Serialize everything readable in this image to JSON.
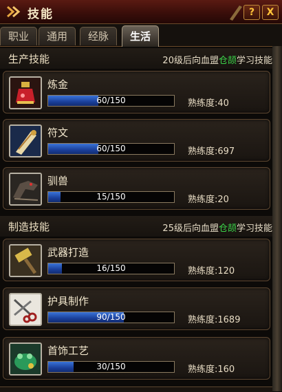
{
  "window": {
    "title": "技能",
    "help_label": "?",
    "close_label": "X"
  },
  "tabs": [
    {
      "label": "职业",
      "active": false
    },
    {
      "label": "通用",
      "active": false
    },
    {
      "label": "经脉",
      "active": false
    },
    {
      "label": "生活",
      "active": true
    }
  ],
  "production": {
    "title": "生产技能",
    "note_prefix": "20级后向血盟",
    "note_highlight": "仓颉",
    "note_suffix": "学习技能",
    "skills": [
      {
        "name": "炼金",
        "level": 60,
        "max": 150,
        "progress_text": "60/150",
        "proficiency_label": "熟练度:",
        "proficiency": "40",
        "icon": "alchemy-potion-icon"
      },
      {
        "name": "符文",
        "level": 60,
        "max": 150,
        "progress_text": "60/150",
        "proficiency_label": "熟练度:",
        "proficiency": "697",
        "icon": "rune-scroll-icon"
      },
      {
        "name": "驯兽",
        "level": 15,
        "max": 150,
        "progress_text": "15/150",
        "proficiency_label": "熟练度:",
        "proficiency": "20",
        "icon": "beast-taming-icon"
      }
    ]
  },
  "crafting": {
    "title": "制造技能",
    "note_prefix": "25级后向血盟",
    "note_highlight": "仓颉",
    "note_suffix": "学习技能",
    "skills": [
      {
        "name": "武器打造",
        "level": 16,
        "max": 150,
        "progress_text": "16/150",
        "proficiency_label": "熟练度:",
        "proficiency": "120",
        "icon": "hammer-icon"
      },
      {
        "name": "护具制作",
        "level": 90,
        "max": 150,
        "progress_text": "90/150",
        "proficiency_label": "熟练度:",
        "proficiency": "1689",
        "icon": "scissors-icon"
      },
      {
        "name": "首饰工艺",
        "level": 30,
        "max": 150,
        "progress_text": "30/150",
        "proficiency_label": "熟练度:",
        "proficiency": "160",
        "icon": "jewelry-toad-icon"
      }
    ]
  },
  "colors": {
    "title_bar": "#3a0e0a",
    "progress_fill": "#2a5cc8",
    "note_highlight": "#3bd64a",
    "close_button": "#ffc33a"
  }
}
